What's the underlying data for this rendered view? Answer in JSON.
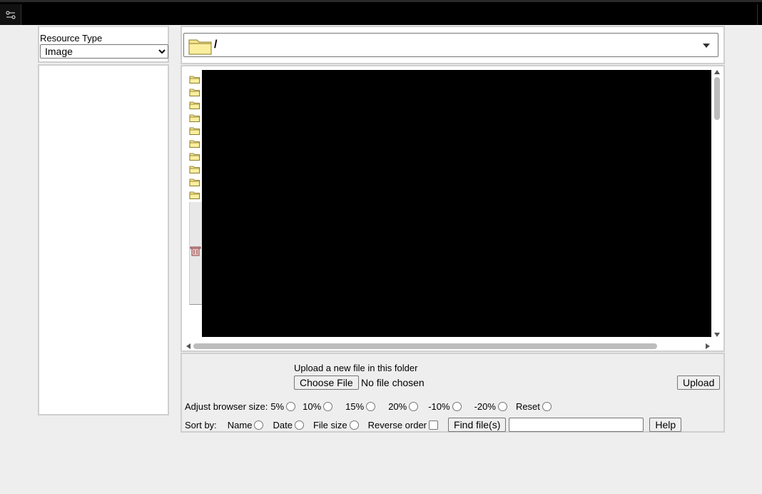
{
  "left_panel": {
    "resource_type_label": "Resource Type",
    "resource_type_selected": "Image"
  },
  "path_bar": {
    "current_path": "/"
  },
  "browser": {
    "folder_count": 10
  },
  "upload": {
    "label": "Upload a new file in this folder",
    "choose_label": "Choose File",
    "no_file_text": "No file chosen",
    "upload_label": "Upload"
  },
  "adjust": {
    "label": "Adjust browser size:",
    "options": [
      "5%",
      "10%",
      "15%",
      "20%",
      "-10%",
      "-20%",
      "Reset"
    ]
  },
  "sort": {
    "label": "Sort by:",
    "name": "Name",
    "date": "Date",
    "file_size": "File size",
    "reverse": "Reverse order",
    "find_label": "Find file(s)",
    "help_label": "Help"
  },
  "colors": {
    "topbar": "#000000",
    "folder": "#f6e58d",
    "preview": "#000000"
  }
}
